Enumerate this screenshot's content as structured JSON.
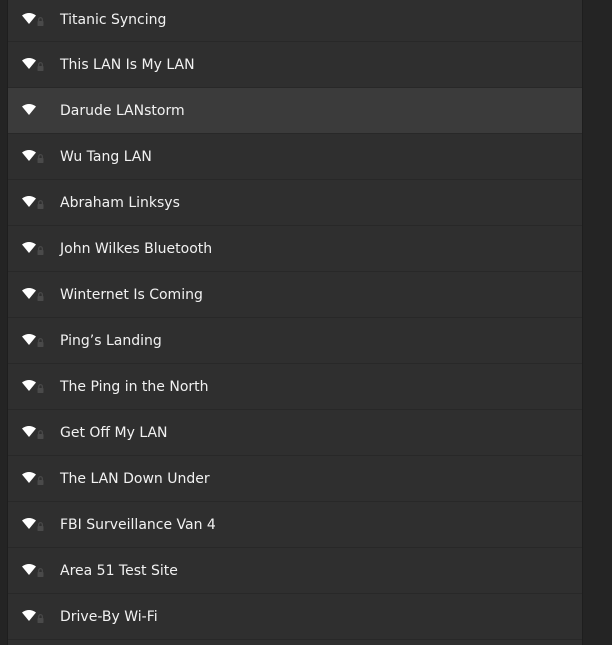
{
  "colors": {
    "background": "#242424",
    "list_background": "#2f2f2f",
    "selected_row": "#3b3b3b",
    "text": "#f2f2f2",
    "icon": "#ffffff",
    "lock_icon": "#4a4a4a"
  },
  "networks": [
    {
      "ssid": "Titanic Syncing",
      "icon": "wifi-signal-full-icon",
      "lock": true,
      "selected": false
    },
    {
      "ssid": "This LAN Is My LAN",
      "icon": "wifi-signal-full-icon",
      "lock": true,
      "selected": false
    },
    {
      "ssid": "Darude LANstorm",
      "icon": "wifi-signal-full-icon",
      "lock": false,
      "selected": true
    },
    {
      "ssid": "Wu Tang LAN",
      "icon": "wifi-signal-full-icon",
      "lock": true,
      "selected": false
    },
    {
      "ssid": "Abraham Linksys",
      "icon": "wifi-signal-full-icon",
      "lock": true,
      "selected": false
    },
    {
      "ssid": "John Wilkes Bluetooth",
      "icon": "wifi-signal-full-icon",
      "lock": true,
      "selected": false
    },
    {
      "ssid": "Winternet Is Coming",
      "icon": "wifi-signal-full-icon",
      "lock": true,
      "selected": false
    },
    {
      "ssid": "Ping’s Landing",
      "icon": "wifi-signal-full-icon",
      "lock": true,
      "selected": false
    },
    {
      "ssid": "The Ping in the North",
      "icon": "wifi-signal-full-icon",
      "lock": true,
      "selected": false
    },
    {
      "ssid": "Get Off My LAN",
      "icon": "wifi-signal-full-icon",
      "lock": true,
      "selected": false
    },
    {
      "ssid": "The LAN Down Under",
      "icon": "wifi-signal-full-icon",
      "lock": true,
      "selected": false
    },
    {
      "ssid": "FBI Surveillance Van 4",
      "icon": "wifi-signal-full-icon",
      "lock": true,
      "selected": false
    },
    {
      "ssid": "Area 51 Test Site",
      "icon": "wifi-signal-full-icon",
      "lock": true,
      "selected": false
    },
    {
      "ssid": "Drive-By Wi-Fi",
      "icon": "wifi-signal-full-icon",
      "lock": true,
      "selected": false
    }
  ]
}
